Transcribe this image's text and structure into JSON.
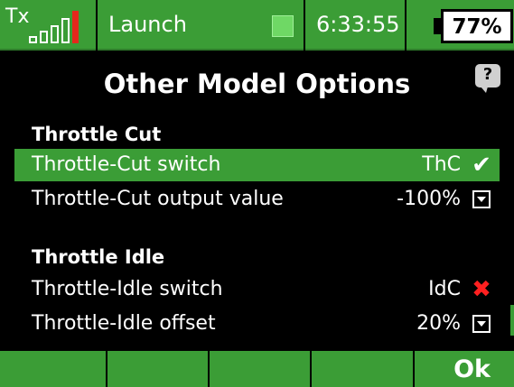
{
  "status_bar": {
    "tx_label": "Tx",
    "model_name": "Launch",
    "time": "6:33:55",
    "battery_percent": "77%",
    "signal_bars": 5,
    "signal_low_indicator_color": "#e5281c",
    "accent_color": "#3b9d36"
  },
  "header": {
    "title": "Other Model Options",
    "help_icon": "?"
  },
  "sections": {
    "throttle_cut": {
      "header": "Throttle Cut",
      "rows": [
        {
          "label": "Throttle-Cut switch",
          "value": "ThC",
          "icon": "check-icon",
          "selected": true
        },
        {
          "label": "Throttle-Cut output value",
          "value": "-100%",
          "icon": "dropdown-icon",
          "selected": false
        }
      ]
    },
    "throttle_idle": {
      "header": "Throttle Idle",
      "rows": [
        {
          "label": "Throttle-Idle switch",
          "value": "IdC",
          "icon": "cross-icon",
          "selected": false
        },
        {
          "label": "Throttle-Idle offset",
          "value": "20%",
          "icon": "dropdown-icon",
          "selected": false
        }
      ]
    }
  },
  "bottom_bar": {
    "softkeys": [
      "",
      "",
      "",
      ""
    ],
    "ok_label": "Ok"
  },
  "icons": {
    "check": "✔",
    "cross": "✖"
  }
}
